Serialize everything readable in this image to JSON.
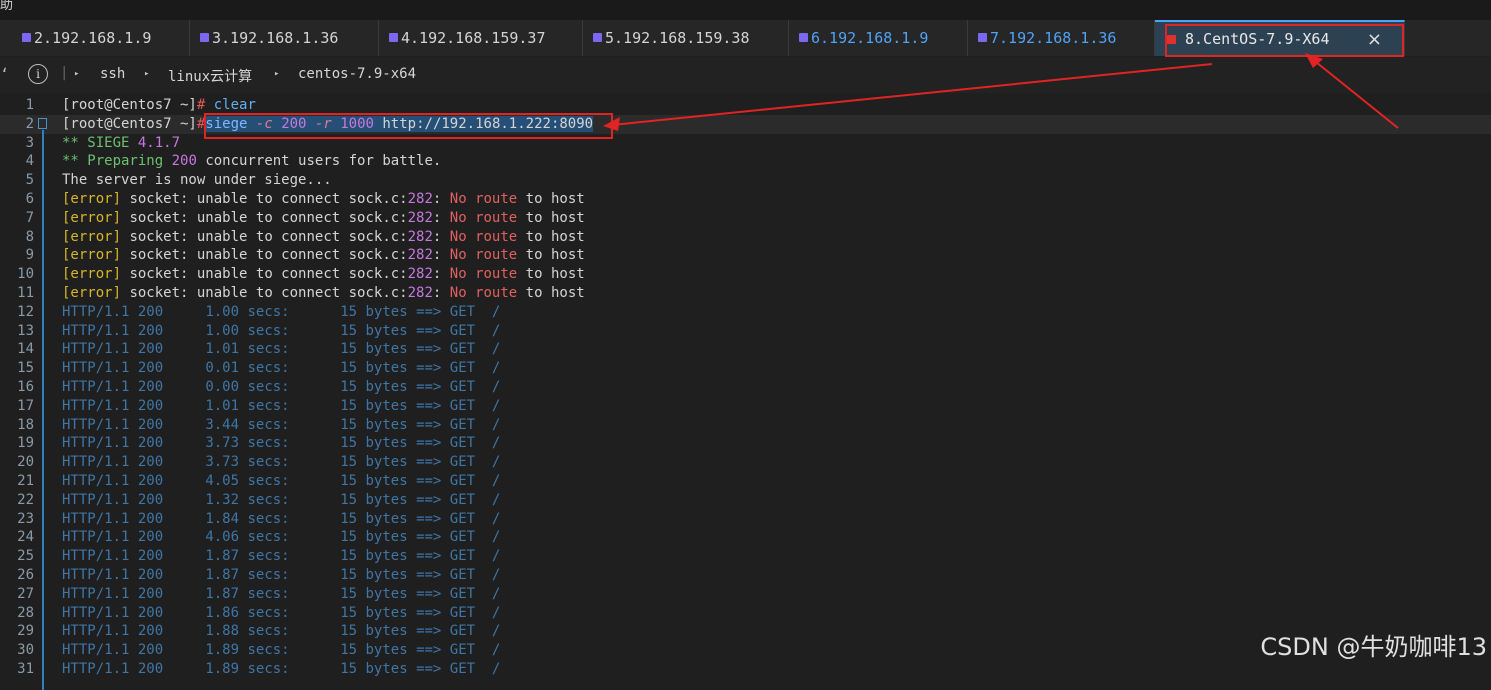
{
  "menu_glyph": "助",
  "tabs": [
    {
      "label": "2.192.168.1.9",
      "color": "#d4d4d4"
    },
    {
      "label": "3.192.168.1.36",
      "color": "#d4d4d4"
    },
    {
      "label": "4.192.168.159.37",
      "color": "#d4d4d4"
    },
    {
      "label": "5.192.168.159.38",
      "color": "#d4d4d4"
    },
    {
      "label": "6.192.168.1.9",
      "color": "#4fa3f7"
    },
    {
      "label": "7.192.168.1.36",
      "color": "#4fa3f7"
    },
    {
      "label": "8.CentOS-7.9-X64",
      "color": "#e8e8e8",
      "active": true
    }
  ],
  "close_glyph": "×",
  "breadcrumb": {
    "info": "i",
    "sep": "|",
    "items": [
      "ssh",
      "linux云计算",
      "centos-7.9-x64"
    ],
    "arrow": "▸"
  },
  "terminal": {
    "prompt": "[root@Centos7 ~]",
    "hash": "#",
    "line1_cmd": "clear",
    "siege": {
      "cmd": "siege",
      "c_flag": "-c",
      "c_val": "200",
      "r_flag": "-r",
      "r_val": "1000",
      "url": "http://192.168.1.222:8090"
    },
    "siege_banner": {
      "prefix": "** SIEGE",
      "version": "4.1.7"
    },
    "preparing": {
      "prefix": "** Preparing",
      "count": "200",
      "suffix": "concurrent users for battle."
    },
    "under_siege": "The server is now under siege...",
    "error_line": {
      "tag": "[error]",
      "msg": "socket: unable to connect sock.c",
      "colon": ":",
      "lineno": "282",
      "colon2": ":",
      "no": "No",
      "route": "route",
      "rest": "to host"
    },
    "error_count": 6,
    "http_rows": [
      {
        "status": "HTTP/1.1 200",
        "secs": "1.00",
        "bytes": "15"
      },
      {
        "status": "HTTP/1.1 200",
        "secs": "1.00",
        "bytes": "15"
      },
      {
        "status": "HTTP/1.1 200",
        "secs": "1.01",
        "bytes": "15"
      },
      {
        "status": "HTTP/1.1 200",
        "secs": "0.01",
        "bytes": "15"
      },
      {
        "status": "HTTP/1.1 200",
        "secs": "0.00",
        "bytes": "15"
      },
      {
        "status": "HTTP/1.1 200",
        "secs": "1.01",
        "bytes": "15"
      },
      {
        "status": "HTTP/1.1 200",
        "secs": "3.44",
        "bytes": "15"
      },
      {
        "status": "HTTP/1.1 200",
        "secs": "3.73",
        "bytes": "15"
      },
      {
        "status": "HTTP/1.1 200",
        "secs": "3.73",
        "bytes": "15"
      },
      {
        "status": "HTTP/1.1 200",
        "secs": "4.05",
        "bytes": "15"
      },
      {
        "status": "HTTP/1.1 200",
        "secs": "1.32",
        "bytes": "15"
      },
      {
        "status": "HTTP/1.1 200",
        "secs": "1.84",
        "bytes": "15"
      },
      {
        "status": "HTTP/1.1 200",
        "secs": "4.06",
        "bytes": "15"
      },
      {
        "status": "HTTP/1.1 200",
        "secs": "1.87",
        "bytes": "15"
      },
      {
        "status": "HTTP/1.1 200",
        "secs": "1.87",
        "bytes": "15"
      },
      {
        "status": "HTTP/1.1 200",
        "secs": "1.87",
        "bytes": "15"
      },
      {
        "status": "HTTP/1.1 200",
        "secs": "1.86",
        "bytes": "15"
      },
      {
        "status": "HTTP/1.1 200",
        "secs": "1.88",
        "bytes": "15"
      },
      {
        "status": "HTTP/1.1 200",
        "secs": "1.89",
        "bytes": "15"
      },
      {
        "status": "HTTP/1.1 200",
        "secs": "1.89",
        "bytes": "15"
      }
    ],
    "http_secs_unit": "secs:",
    "http_bytes_unit": "bytes ==> GET  /"
  },
  "watermark": "CSDN @牛奶咖啡13"
}
